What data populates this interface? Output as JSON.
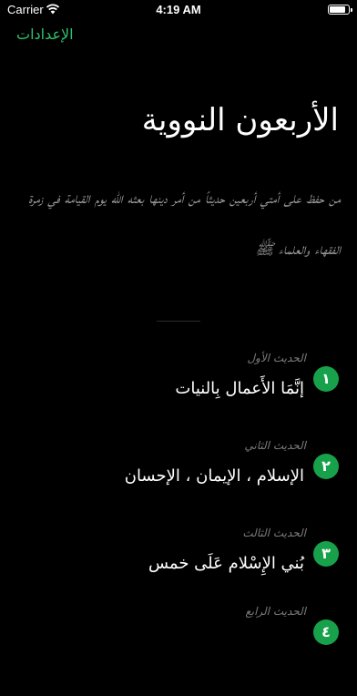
{
  "status": {
    "carrier": "Carrier",
    "time": "4:19 AM",
    "battery_level": 0.9
  },
  "nav": {
    "settings_label": "الإعدادات"
  },
  "header": {
    "title": "الأربعون النووية",
    "intro": "من حفظ على أمتي أربعين حديثاً من أمر دينها بعثه الله يوم القيامة في زمرة الفقهاء والعلماء ﷺ"
  },
  "hadiths": [
    {
      "num": "١",
      "label": "الحديث الأول",
      "title": "إنَّمَا الأَعمال بِالنيات"
    },
    {
      "num": "٢",
      "label": "الحديث الثاني",
      "title": "الإسلام ، الإيمان ، الإحسان"
    },
    {
      "num": "٣",
      "label": "الحديث الثالث",
      "title": "بُني الإِسْلام عَلَى خمس"
    },
    {
      "num": "٤",
      "label": "الحديث الرابع",
      "title": ""
    }
  ]
}
